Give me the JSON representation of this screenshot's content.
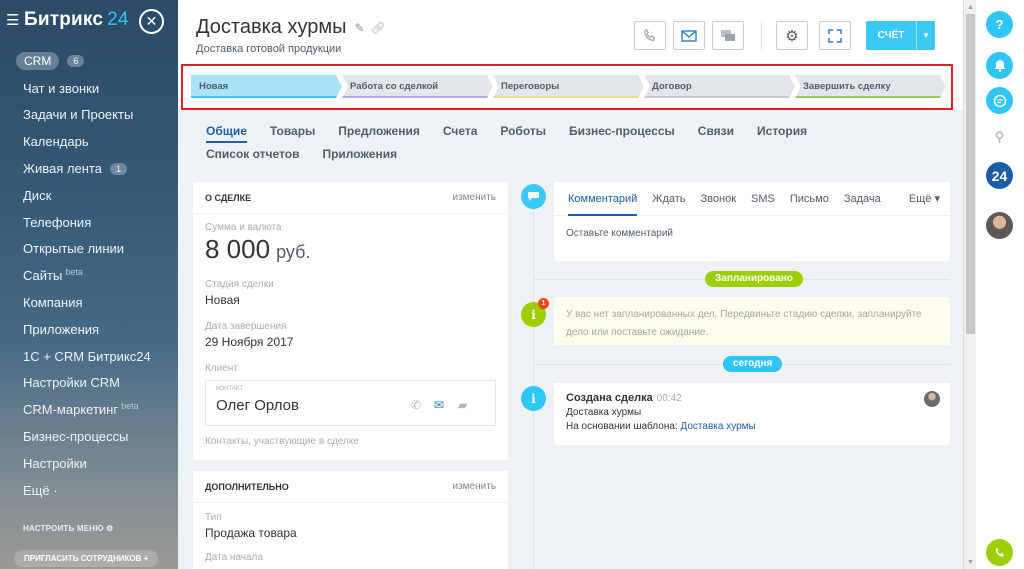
{
  "sidebar": {
    "logo_main": "Битрикс",
    "logo_num": "24",
    "close": "✕",
    "items": [
      {
        "label": "CRM",
        "badge": "6"
      },
      {
        "label": "Чат и звонки"
      },
      {
        "label": "Задачи и Проекты"
      },
      {
        "label": "Календарь"
      },
      {
        "label": "Живая лента",
        "badge": "1"
      },
      {
        "label": "Диск"
      },
      {
        "label": "Телефония"
      },
      {
        "label": "Открытые линии"
      },
      {
        "label": "Сайты",
        "beta": "beta"
      },
      {
        "label": "Компания"
      },
      {
        "label": "Приложения"
      },
      {
        "label": "1С + CRM Битрикс24"
      },
      {
        "label": "Настройки CRM"
      },
      {
        "label": "CRM-маркетинг",
        "beta": "beta"
      },
      {
        "label": "Бизнес-процессы"
      },
      {
        "label": "Настройки"
      },
      {
        "label": "Ещё ·"
      }
    ],
    "configure_menu": "НАСТРОИТЬ МЕНЮ",
    "invite": "ПРИГЛАСИТЬ СОТРУДНИКОВ +"
  },
  "header": {
    "title": "Доставка хурмы",
    "subtitle": "Доставка готовой продукции",
    "invoice_button": "СЧЁТ"
  },
  "stages": [
    {
      "label": "Новая",
      "color": "#a8e2f7",
      "bar": "#3bc8f5"
    },
    {
      "label": "Работа со сделкой",
      "color": "#e2e6e9",
      "bar": "#b5a7e8"
    },
    {
      "label": "Переговоры",
      "color": "#e2e6e9",
      "bar": "#f2d97a"
    },
    {
      "label": "Договор",
      "color": "#e2e6e9",
      "bar": "#c4c9cd"
    },
    {
      "label": "Завершить сделку",
      "color": "#e2e6e9",
      "bar": "#8fd14f"
    }
  ],
  "tabs": [
    "Общие",
    "Товары",
    "Предложения",
    "Счета",
    "Роботы",
    "Бизнес-процессы",
    "Связи",
    "История",
    "Список отчетов",
    "Приложения"
  ],
  "about": {
    "title": "О СДЕЛКЕ",
    "edit": "изменить",
    "amount_label": "Сумма и валюта",
    "amount": "8 000",
    "currency": "руб.",
    "stage_label": "Стадия сделки",
    "stage_value": "Новая",
    "close_label": "Дата завершения",
    "close_value": "29 Ноября 2017",
    "client_label": "Клиент",
    "contact_kind": "КОНТАКТ",
    "contact_name": "Олег Орлов",
    "contacts_note": "Контакты, участвующие в сделке"
  },
  "extra": {
    "title": "ДОПОЛНИТЕЛЬНО",
    "edit": "изменить",
    "type_label": "Тип",
    "type_value": "Продажа товара",
    "start_label": "Дата начала"
  },
  "composer": {
    "tabs": [
      "Комментарий",
      "Ждать",
      "Звонок",
      "SMS",
      "Письмо",
      "Задача"
    ],
    "more": "Ещё ▾",
    "placeholder": "Оставьте комментарий"
  },
  "timeline": {
    "planned": "Запланировано",
    "planned_count": "1",
    "notice_line1": "У вас нет запланированных дел. Передвиньте стадию сделки, запланируйте",
    "notice_line2": "дело или поставьте ожидание.",
    "today": "сегодня",
    "event_title": "Создана сделка",
    "event_time": "00:42",
    "event_line1": "Доставка хурмы",
    "event_line2_prefix": "На основании шаблона:",
    "event_link": "Доставка хурмы"
  },
  "rightbar": {
    "help": "?",
    "b24": "24"
  },
  "colors": {
    "accent": "#3bc8f5",
    "link": "#1b5ea8",
    "planned_pill": "#9dcf00",
    "today_pill": "#2fc6f6",
    "info_dot": "#9dcf00",
    "event_dot": "#2fc6f6",
    "highlight_frame": "#d8232a"
  }
}
